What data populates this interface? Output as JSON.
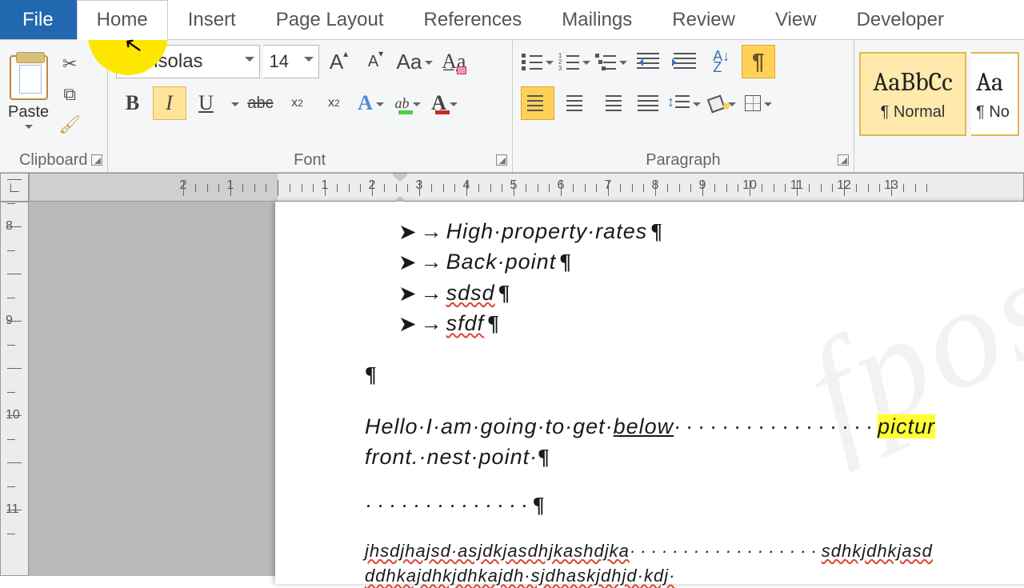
{
  "tabs": {
    "file": "File",
    "home": "Home",
    "insert": "Insert",
    "page_layout": "Page Layout",
    "references": "References",
    "mailings": "Mailings",
    "review": "Review",
    "view": "View",
    "developer": "Developer"
  },
  "clipboard": {
    "paste": "Paste",
    "group": "Clipboard"
  },
  "font": {
    "group": "Font",
    "name": "Consolas",
    "size": "14",
    "bold": "B",
    "italic": "I",
    "underline": "U",
    "strike": "abc",
    "sub": "x",
    "sub2": "2",
    "sup": "x",
    "sup2": "2",
    "grow": "A",
    "grow_tri": "▴",
    "shrink": "A",
    "shrink_tri": "▾",
    "case": "Aa",
    "absym": "ab"
  },
  "paragraph": {
    "group": "Paragraph",
    "sort": "A\nZ",
    "pilcrow": "¶"
  },
  "styles": {
    "sample": "AaBbCc",
    "normal": "¶ Normal",
    "sample2": "Aa",
    "partial": "¶ No"
  },
  "ruler": {
    "h": [
      "2",
      "1",
      "",
      "1",
      "2",
      "3",
      "4",
      "5",
      "6",
      "7",
      "8",
      "9",
      "10",
      "11",
      "12",
      "13"
    ],
    "v": [
      "8",
      "9",
      "10",
      "11"
    ]
  },
  "doc": {
    "b1": "High·property·rates",
    "b2": "Back·point",
    "b3": "sdsd",
    "b4": "sfdf",
    "arrow": "➤",
    "tab": "→",
    "pm": "¶",
    "hello1": "Hello·I·am·going·to·get·",
    "below": "below",
    "dots1": "·················",
    "pictur": "pictur",
    "line2": "front.·nest·point·",
    "dots2": "··············",
    "g1": "jhsdjhajsd·asjdkjasdhjkashdjka",
    "gdots": "··················",
    "g1b": "sdhkjdhkjasd",
    "g2": "ddhkajdhkjdhkajdh·sjdhaskjdhjd·kdj·"
  }
}
